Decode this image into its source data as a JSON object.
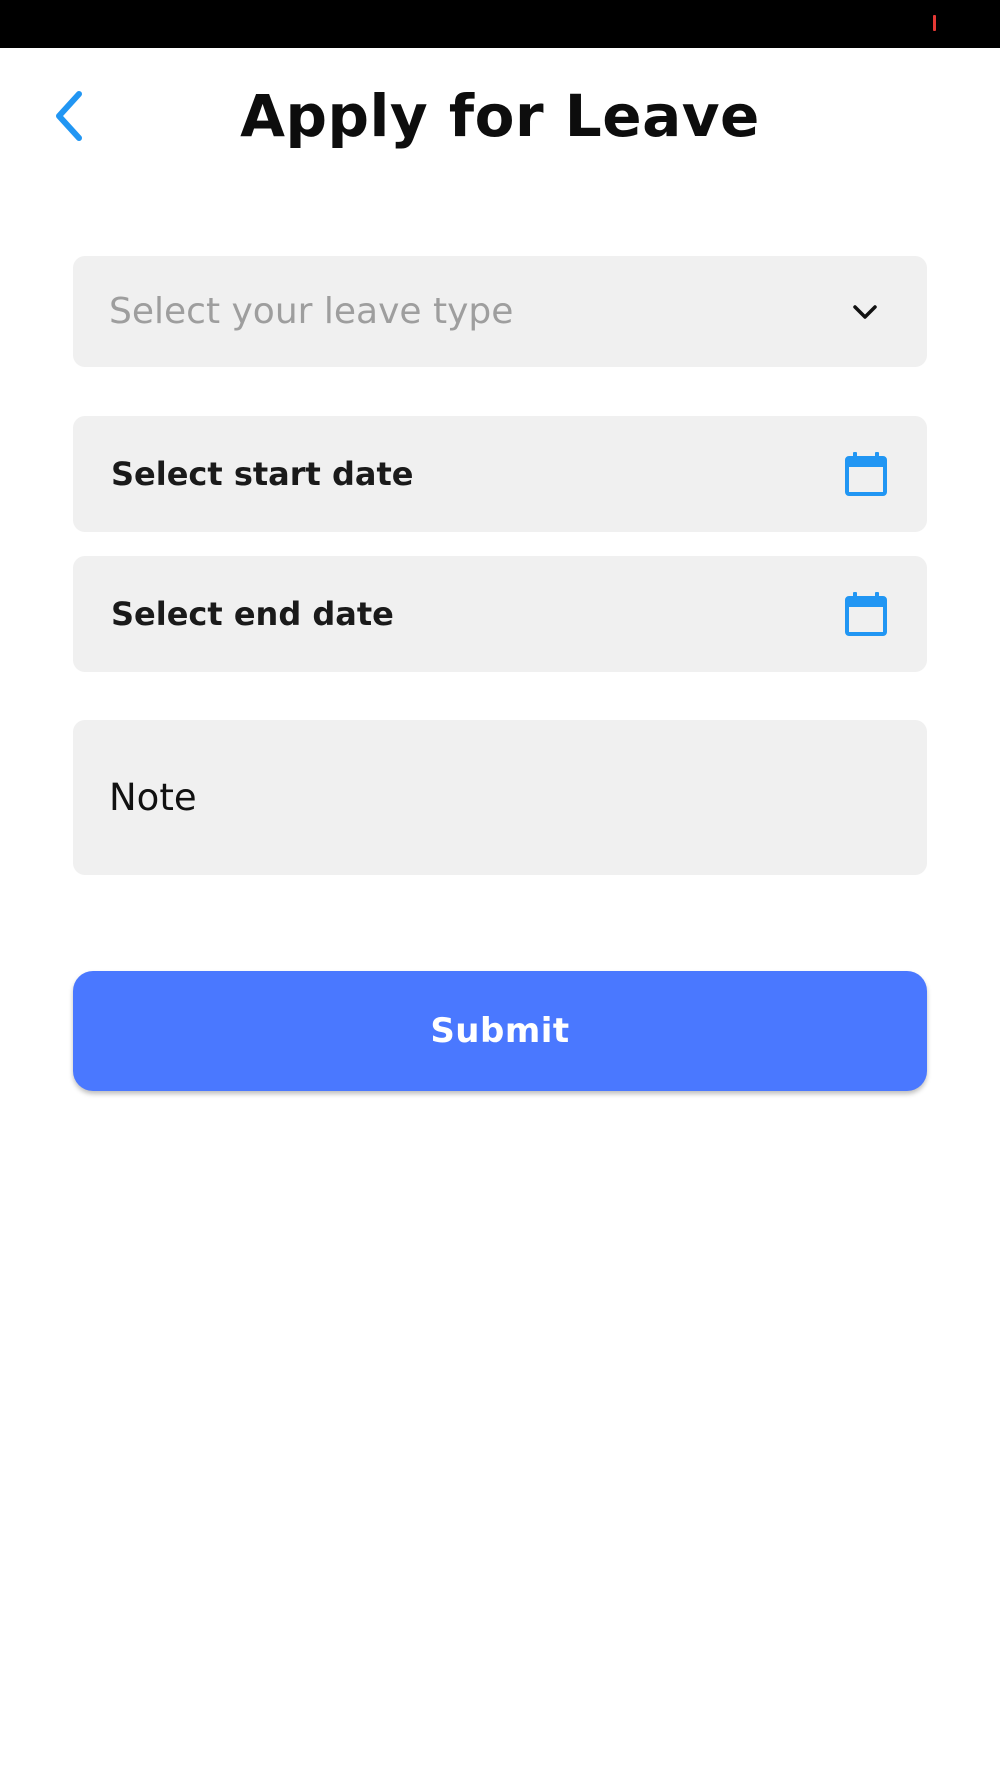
{
  "header": {
    "title": "Apply for Leave",
    "back_icon": "chevron-left-icon"
  },
  "form": {
    "leave_type": {
      "placeholder": "Select your leave type",
      "icon": "chevron-down-icon"
    },
    "start_date": {
      "label": "Select start date",
      "icon": "calendar-icon"
    },
    "end_date": {
      "label": "Select end date",
      "icon": "calendar-icon"
    },
    "note": {
      "label": "Note"
    },
    "submit_label": "Submit"
  },
  "colors": {
    "accent_blue": "#2196f3",
    "button_blue": "#4a78ff",
    "field_bg": "#f0f0f0",
    "placeholder": "#9e9e9e",
    "status_bar": "#000000",
    "status_indicator": "#e53935"
  }
}
